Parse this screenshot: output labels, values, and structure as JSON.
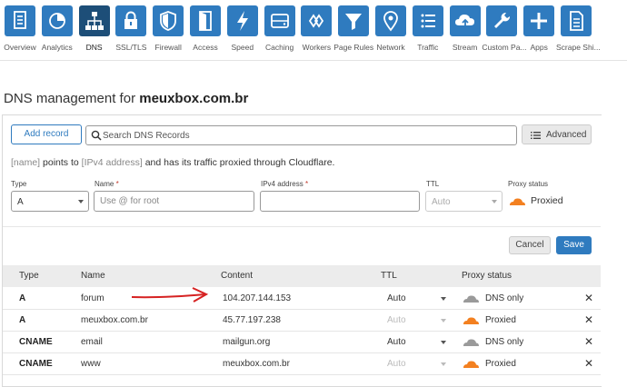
{
  "nav": {
    "items": [
      {
        "label": "Overview",
        "icon": "document-icon"
      },
      {
        "label": "Analytics",
        "icon": "pie-chart-icon"
      },
      {
        "label": "DNS",
        "icon": "network-tree-icon"
      },
      {
        "label": "SSL/TLS",
        "icon": "lock-icon"
      },
      {
        "label": "Firewall",
        "icon": "shield-icon"
      },
      {
        "label": "Access",
        "icon": "door-icon"
      },
      {
        "label": "Speed",
        "icon": "lightning-icon"
      },
      {
        "label": "Caching",
        "icon": "hard-drive-icon"
      },
      {
        "label": "Workers",
        "icon": "workers-icon"
      },
      {
        "label": "Page Rules",
        "icon": "filter-icon"
      },
      {
        "label": "Network",
        "icon": "location-pin-icon"
      },
      {
        "label": "Traffic",
        "icon": "list-icon"
      },
      {
        "label": "Stream",
        "icon": "cloud-upload-icon"
      },
      {
        "label": "Custom Pa...",
        "icon": "wrench-icon"
      },
      {
        "label": "Apps",
        "icon": "plus-icon"
      },
      {
        "label": "Scrape Shi...",
        "icon": "scrape-shield-icon"
      }
    ],
    "active_index": 2,
    "accent": "#2f7bbf",
    "active_color": "#1d4e78"
  },
  "page": {
    "title_prefix": "DNS management for",
    "domain": "meuxbox.com.br"
  },
  "toolbar": {
    "add_record_label": "Add record",
    "search_placeholder": "Search DNS Records",
    "advanced_label": "Advanced"
  },
  "hint": {
    "name_tag": "[name]",
    "text1": "points to",
    "ip_tag": "[IPv4 address]",
    "text2": "and has its traffic proxied through Cloudflare."
  },
  "form": {
    "type_label": "Type",
    "type_value": "A",
    "name_label": "Name",
    "name_placeholder": "Use @ for root",
    "ipv4_label": "IPv4 address",
    "ipv4_value": "",
    "ttl_label": "TTL",
    "ttl_value": "Auto",
    "proxy_label": "Proxy status",
    "proxy_value": "Proxied",
    "required_mark": "*",
    "cancel_label": "Cancel",
    "save_label": "Save"
  },
  "table": {
    "headers": {
      "type": "Type",
      "name": "Name",
      "content": "Content",
      "ttl": "TTL",
      "proxy": "Proxy status"
    },
    "rows": [
      {
        "type": "A",
        "name": "forum",
        "content": "104.207.144.153",
        "ttl": "Auto",
        "ttl_editable": true,
        "proxy": "DNS only",
        "proxied": false
      },
      {
        "type": "A",
        "name": "meuxbox.com.br",
        "content": "45.77.197.238",
        "ttl": "Auto",
        "ttl_editable": false,
        "proxy": "Proxied",
        "proxied": true
      },
      {
        "type": "CNAME",
        "name": "email",
        "content": "mailgun.org",
        "ttl": "Auto",
        "ttl_editable": true,
        "proxy": "DNS only",
        "proxied": false
      },
      {
        "type": "CNAME",
        "name": "www",
        "content": "meuxbox.com.br",
        "ttl": "Auto",
        "ttl_editable": false,
        "proxy": "Proxied",
        "proxied": true
      }
    ],
    "delete_glyph": "✕"
  },
  "colors": {
    "proxied_cloud": "#f38020",
    "dns_only_cloud": "#9a9a9a",
    "annotation_arrow": "#d62222"
  }
}
